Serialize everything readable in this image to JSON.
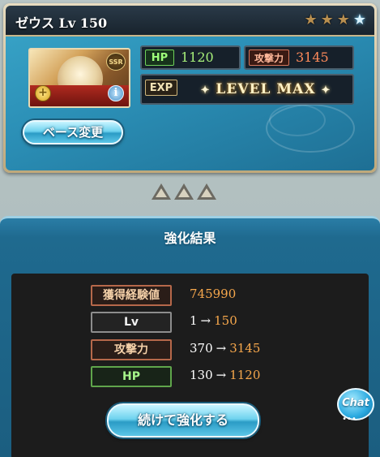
{
  "character": {
    "name": "ゼウス",
    "level_text": "Lv 150",
    "rarity_badge": "SSR",
    "stars": [
      {
        "icon": "star-gold-icon",
        "glyph": "★"
      },
      {
        "icon": "star-gold-icon",
        "glyph": "★"
      },
      {
        "icon": "star-gold-icon",
        "glyph": "★"
      },
      {
        "icon": "star-blue-icon",
        "glyph": "★"
      }
    ]
  },
  "stats": {
    "hp_label": "HP",
    "hp_value": "1120",
    "atk_label": "攻撃力",
    "atk_value": "3145",
    "exp_label": "EXP",
    "exp_value": "LEVEL MAX"
  },
  "buttons": {
    "base_change": "ベース変更",
    "continue": "続けて強化する",
    "chat": "Chat"
  },
  "result": {
    "title": "強化結果",
    "rows": [
      {
        "label": "獲得経験値",
        "before": "",
        "after": "745990"
      },
      {
        "label": "Lv",
        "before": "1",
        "after": "150"
      },
      {
        "label": "攻撃力",
        "before": "370",
        "after": "3145"
      },
      {
        "label": "HP",
        "before": "130",
        "after": "1120"
      }
    ],
    "arrow": "→"
  },
  "colors": {
    "panel_blue": "#2b8fb6",
    "highlight_orange": "#f6a74c",
    "hp_green": "#a7f07a",
    "atk_orange": "#ff8a5a"
  }
}
